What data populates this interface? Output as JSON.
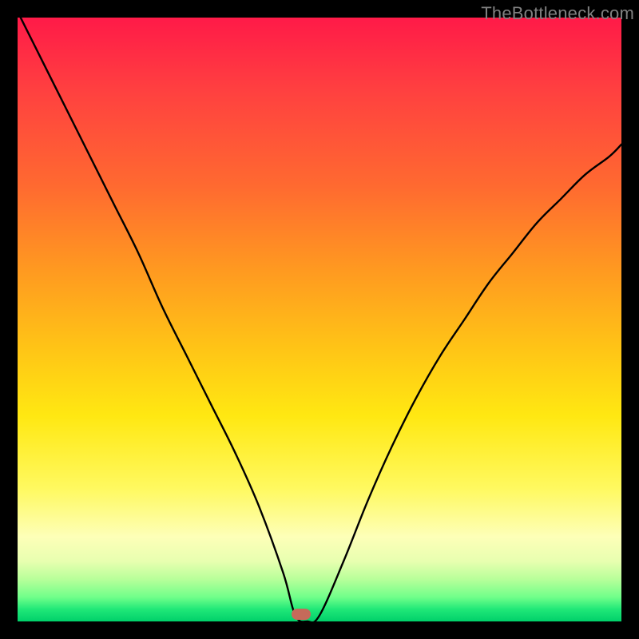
{
  "watermark": "TheBottleneck.com",
  "chart_data": {
    "type": "line",
    "title": "",
    "xlabel": "",
    "ylabel": "",
    "xlim": [
      0,
      100
    ],
    "ylim": [
      0,
      100
    ],
    "grid": false,
    "marker": {
      "x": 47,
      "y": 0
    },
    "colors": {
      "gradient_top": "#ff1a48",
      "gradient_mid": "#ffe812",
      "gradient_bottom": "#00d06a",
      "curve": "#000000",
      "marker": "#c56a5a",
      "frame": "#000000"
    },
    "series": [
      {
        "name": "bottleneck-curve",
        "x": [
          0,
          4,
          8,
          12,
          16,
          20,
          24,
          28,
          32,
          36,
          40,
          44,
          46,
          48,
          50,
          54,
          58,
          62,
          66,
          70,
          74,
          78,
          82,
          86,
          90,
          94,
          98,
          100
        ],
        "y": [
          101,
          93,
          85,
          77,
          69,
          61,
          52,
          44,
          36,
          28,
          19,
          8,
          1,
          0,
          1,
          10,
          20,
          29,
          37,
          44,
          50,
          56,
          61,
          66,
          70,
          74,
          77,
          79
        ]
      }
    ]
  }
}
